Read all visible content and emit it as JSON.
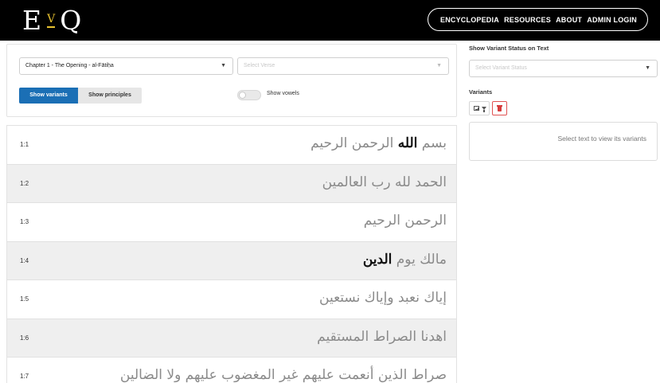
{
  "header": {
    "logo": {
      "left": "E",
      "middle": "V",
      "right": "Q"
    },
    "nav": [
      "ENCYCLOPEDIA",
      "RESOURCES",
      "ABOUT",
      "ADMIN LOGIN"
    ]
  },
  "controls": {
    "chapter_select": {
      "value": "Chapter 1 - The Opening - al-Fātiḥa"
    },
    "verse_select": {
      "placeholder": "Select Verse"
    },
    "buttons": {
      "variants": "Show variants",
      "principles": "Show principles"
    },
    "vowels_toggle": {
      "label": "Show vowels",
      "on": false
    }
  },
  "verses": [
    {
      "num": "1:1",
      "before": "بسم ",
      "highlight": "الله",
      "after": " الرحمن الرحيم"
    },
    {
      "num": "1:2",
      "before": "الحمد لله رب العالمين",
      "highlight": "",
      "after": ""
    },
    {
      "num": "1:3",
      "before": "الرحمن الرحيم",
      "highlight": "",
      "after": ""
    },
    {
      "num": "1:4",
      "before": "مالك يوم ",
      "highlight": "الدين",
      "after": ""
    },
    {
      "num": "1:5",
      "before": "إياك نعبد وإياك نستعين",
      "highlight": "",
      "after": ""
    },
    {
      "num": "1:6",
      "before": "اهدنا الصراط المستقيم",
      "highlight": "",
      "after": ""
    },
    {
      "num": "1:7",
      "before": "صراط الذين أنعمت عليهم غير المغضوب عليهم ولا الضالين",
      "highlight": "",
      "after": ""
    }
  ],
  "sidebar": {
    "status_title": "Show Variant Status on Text",
    "status_select": {
      "placeholder": "Select Variant Status"
    },
    "variants_title": "Variants",
    "icons": [
      "table-filter-icon",
      "trash-icon"
    ],
    "empty_message": "Select text to view its variants"
  },
  "colors": {
    "accent": "#1b6fb5",
    "logo_v": "#e8c230",
    "danger": "#d63b3b"
  }
}
